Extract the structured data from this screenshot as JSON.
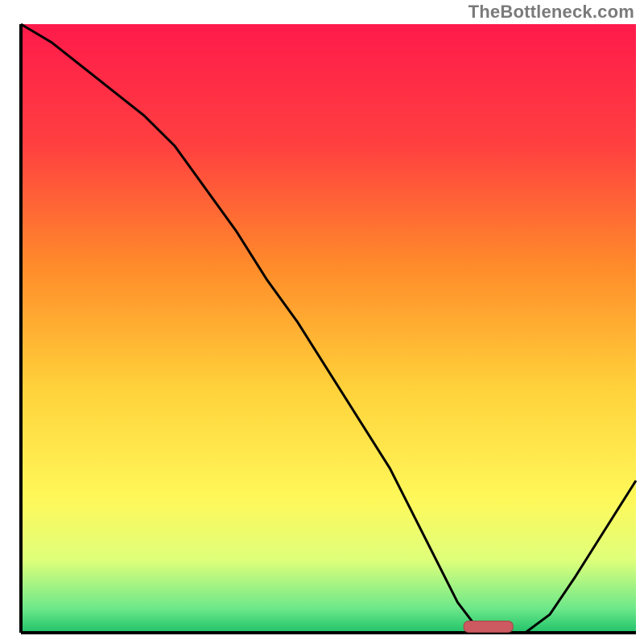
{
  "watermark": "TheBottleneck.com",
  "chart_data": {
    "type": "line",
    "title": "",
    "xlabel": "",
    "ylabel": "",
    "xlim": [
      0,
      100
    ],
    "ylim": [
      0,
      100
    ],
    "x": [
      0,
      5,
      10,
      15,
      20,
      25,
      30,
      35,
      40,
      45,
      50,
      55,
      60,
      64,
      68,
      71,
      74,
      78,
      82,
      86,
      90,
      95,
      100
    ],
    "values": [
      100,
      97,
      93,
      89,
      85,
      80,
      73,
      66,
      58,
      51,
      43,
      35,
      27,
      19,
      11,
      5,
      1,
      0,
      0,
      3,
      9,
      17,
      25
    ],
    "marker": {
      "x_start": 72,
      "x_end": 80,
      "y": 1
    },
    "gradient_stops": [
      {
        "offset": 0,
        "color": "#ff1a4b"
      },
      {
        "offset": 20,
        "color": "#ff4040"
      },
      {
        "offset": 40,
        "color": "#ff8c2a"
      },
      {
        "offset": 60,
        "color": "#ffd23a"
      },
      {
        "offset": 78,
        "color": "#fff85a"
      },
      {
        "offset": 88,
        "color": "#dfff7a"
      },
      {
        "offset": 96,
        "color": "#6de88a"
      },
      {
        "offset": 100,
        "color": "#20c26a"
      }
    ],
    "axis_color": "#000000",
    "curve_color": "#000000",
    "marker_fill": "#cc5a60",
    "marker_stroke": "#a64448"
  }
}
